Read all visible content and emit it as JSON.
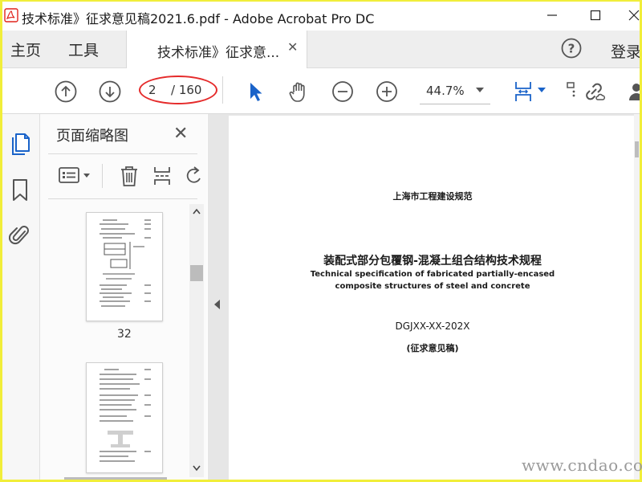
{
  "window": {
    "title": "技术标准》征求意见稿2021.6.pdf - Adobe Acrobat Pro DC"
  },
  "tabs": {
    "home": "主页",
    "tools": "工具",
    "document": "技术标准》征求意...",
    "login": "登录"
  },
  "toolbar": {
    "current_page": "2",
    "total_pages": "/ 160",
    "zoom": "44.7%"
  },
  "panel": {
    "title": "页面缩略图",
    "thumbnails": [
      {
        "label": "32"
      }
    ]
  },
  "document": {
    "publisher": "上海市工程建设规范",
    "title_cn": "装配式部分包覆钢-混凝土组合结构技术规程",
    "title_en_1": "Technical specification of fabricated partially-encased",
    "title_en_2": "composite structures of steel and concrete",
    "code": "DGJXX-XX-202X",
    "status": "(征求意见稿)"
  },
  "watermark": "www.cndao.com",
  "colors": {
    "frame": "#f1ee3a",
    "accent_blue": "#1a63c9",
    "annotation_red": "#e52a2a",
    "pdf_red": "#e0231c"
  },
  "icons": [
    "pdf-app-icon",
    "minimize-icon",
    "maximize-icon",
    "close-icon",
    "help-icon",
    "page-up-icon",
    "page-down-icon",
    "select-arrow-icon",
    "hand-icon",
    "zoom-out-icon",
    "zoom-in-icon",
    "fit-page-icon",
    "share-link-icon",
    "user-icon",
    "pages-icon",
    "bookmark-icon",
    "attachment-icon",
    "options-icon",
    "delete-icon",
    "insert-page-icon",
    "rotate-icon",
    "collapse-panel-icon"
  ]
}
